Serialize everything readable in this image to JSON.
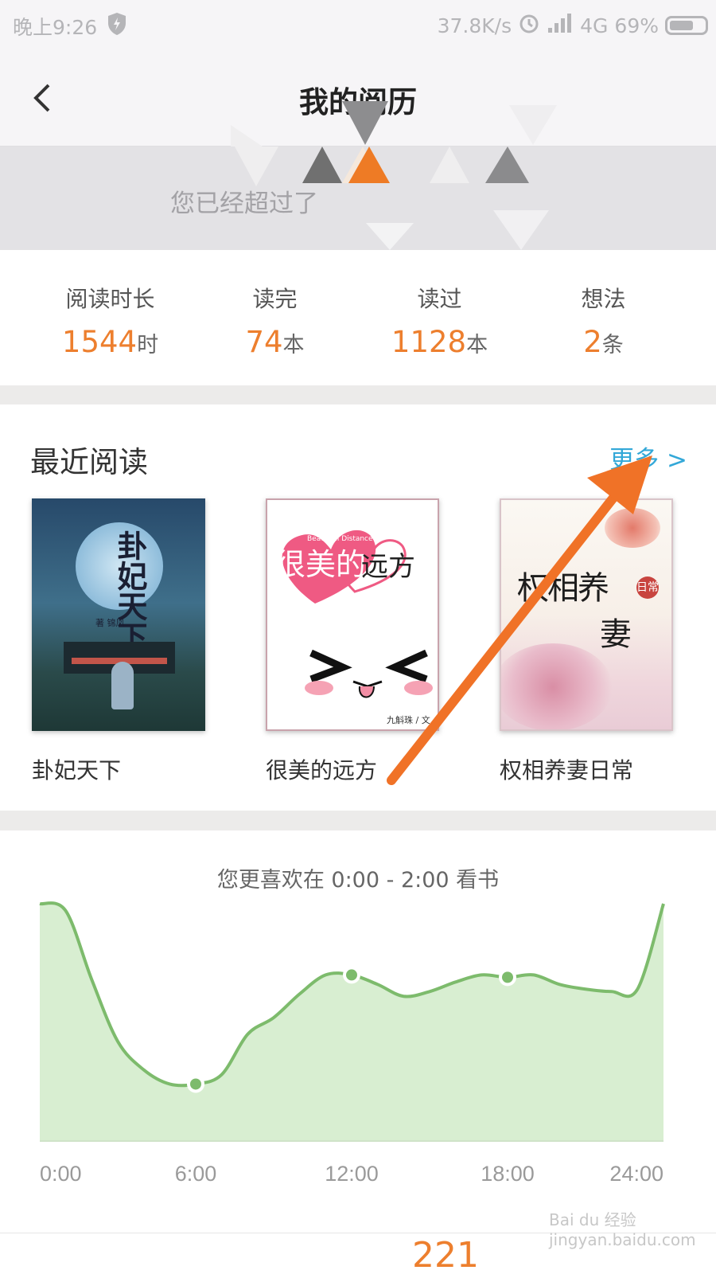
{
  "status_bar": {
    "time": "晚上9:26",
    "speed": "37.8K/s",
    "network": "4G",
    "battery": "69%",
    "battery_level": 0.69
  },
  "header": {
    "title": "我的阅历"
  },
  "banner": {
    "text": "您已经超过了"
  },
  "stats": [
    {
      "label": "阅读时长",
      "value": "1544",
      "unit": "时"
    },
    {
      "label": "读完",
      "value": "74",
      "unit": "本"
    },
    {
      "label": "读过",
      "value": "1128",
      "unit": "本"
    },
    {
      "label": "想法",
      "value": "2",
      "unit": "条"
    }
  ],
  "recent": {
    "title": "最近阅读",
    "more": "更多 >",
    "books": [
      {
        "title": "卦妃天下",
        "cover_text": "卦妃天下",
        "cover_author": "著 锦凤"
      },
      {
        "title": "很美的远方",
        "cover_text": "很美的远方",
        "cover_subtitle": "Beautiful Distance",
        "cover_author": "九斛珠 / 文"
      },
      {
        "title": "权相养妻日常",
        "cover_text": "权相养妻日常"
      }
    ]
  },
  "chart_caption": "您更喜欢在 0:00 - 2:00 看书",
  "chart_data": {
    "type": "area",
    "x_ticks": [
      "0:00",
      "6:00",
      "12:00",
      "18:00",
      "24:00"
    ],
    "x": [
      0,
      1,
      2,
      3,
      4,
      5,
      6,
      7,
      8,
      9,
      10,
      11,
      12,
      13,
      14,
      15,
      16,
      17,
      18,
      19,
      20,
      21,
      22,
      23,
      24
    ],
    "values": [
      100,
      97,
      68,
      42,
      30,
      24,
      24,
      28,
      45,
      52,
      62,
      70,
      70,
      66,
      61,
      63,
      67,
      70,
      69,
      70,
      66,
      64,
      63,
      64,
      100
    ],
    "highlight_x": [
      6,
      12,
      18
    ],
    "ylim": [
      0,
      100
    ],
    "color": "#7dbb6c",
    "fill": "#d8eed1"
  },
  "bottom": {
    "number": "221"
  },
  "watermark": "Bai du 经验 jingyan.baidu.com"
}
